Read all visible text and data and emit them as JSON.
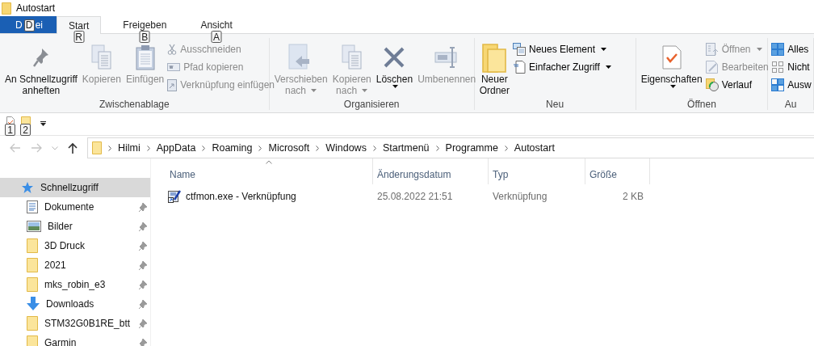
{
  "window": {
    "title": "Autostart"
  },
  "tabs": [
    {
      "label": "D",
      "label_after": "ei",
      "keytip": "D",
      "kind": "file",
      "selected": false
    },
    {
      "label": "Start",
      "keytip": "R",
      "kind": "tab",
      "selected": true
    },
    {
      "label": "Freigeben",
      "keytip": "B",
      "kind": "tab",
      "selected": false
    },
    {
      "label": "Ansicht",
      "keytip": "A",
      "kind": "tab",
      "selected": false
    }
  ],
  "ribbon": [
    {
      "label": "Zwischenablage",
      "items": [
        {
          "kind": "large",
          "lines": [
            "An Schnellzugriff",
            "anheften"
          ],
          "dropdown": false,
          "disabled": false
        },
        {
          "kind": "large",
          "lines": [
            "Kopieren"
          ],
          "dropdown": false,
          "disabled": true
        },
        {
          "kind": "large",
          "lines": [
            "Einfügen"
          ],
          "dropdown": false,
          "disabled": true
        },
        {
          "kind": "small",
          "lines": [
            "Ausschneiden"
          ],
          "dropdown": false,
          "disabled": true
        },
        {
          "kind": "small",
          "lines": [
            "Pfad kopieren"
          ],
          "dropdown": false,
          "disabled": true
        },
        {
          "kind": "small",
          "lines": [
            "Verknüpfung einfügen"
          ],
          "dropdown": false,
          "disabled": true
        }
      ]
    },
    {
      "label": "Organisieren",
      "items": [
        {
          "kind": "large",
          "lines": [
            "Verschieben",
            "nach"
          ],
          "dropdown": true,
          "disabled": true
        },
        {
          "kind": "large",
          "lines": [
            "Kopieren",
            "nach"
          ],
          "dropdown": true,
          "disabled": true
        },
        {
          "kind": "large",
          "lines": [
            "Löschen"
          ],
          "dropdown": true,
          "disabled": false
        },
        {
          "kind": "large",
          "lines": [
            "Umbenennen"
          ],
          "dropdown": false,
          "disabled": true
        }
      ]
    },
    {
      "label": "Neu",
      "items": [
        {
          "kind": "large",
          "lines": [
            "Neuer",
            "Ordner"
          ],
          "dropdown": false,
          "disabled": false
        },
        {
          "kind": "small",
          "lines": [
            "Neues Element"
          ],
          "dropdown": true,
          "disabled": false
        },
        {
          "kind": "small",
          "lines": [
            "Einfacher Zugriff"
          ],
          "dropdown": true,
          "disabled": false
        }
      ]
    },
    {
      "label": "Öffnen",
      "items": [
        {
          "kind": "large",
          "lines": [
            "Eigenschaften"
          ],
          "dropdown": true,
          "disabled": false
        },
        {
          "kind": "small",
          "lines": [
            "Öffnen"
          ],
          "dropdown": true,
          "disabled": true
        },
        {
          "kind": "small",
          "lines": [
            "Bearbeiten"
          ],
          "dropdown": false,
          "disabled": true
        },
        {
          "kind": "small",
          "lines": [
            "Verlauf"
          ],
          "dropdown": false,
          "disabled": false
        }
      ]
    },
    {
      "label": "Au",
      "items": [
        {
          "kind": "small",
          "lines": [
            "Alles"
          ],
          "dropdown": false,
          "disabled": false
        },
        {
          "kind": "small",
          "lines": [
            "Nicht"
          ],
          "dropdown": false,
          "disabled": false
        },
        {
          "kind": "small",
          "lines": [
            "Ausw"
          ],
          "dropdown": false,
          "disabled": false
        }
      ]
    }
  ],
  "quick_access": {
    "keytips": [
      "1",
      "2"
    ]
  },
  "address": {
    "crumbs": [
      "Hilmi",
      "AppData",
      "Roaming",
      "Microsoft",
      "Windows",
      "Startmenü",
      "Programme",
      "Autostart"
    ]
  },
  "sidebar": {
    "items": [
      {
        "label": "Schnellzugriff",
        "kind": "quick",
        "pinned": false,
        "selected": true,
        "children": [
          {
            "label": "Dokumente",
            "kind": "documents",
            "pinned": true,
            "selected": false
          },
          {
            "label": "Bilder",
            "kind": "pictures",
            "pinned": true,
            "selected": false
          },
          {
            "label": "3D Druck",
            "kind": "folder",
            "pinned": true,
            "selected": false
          },
          {
            "label": "2021",
            "kind": "folder",
            "pinned": true,
            "selected": false
          },
          {
            "label": "mks_robin_e3",
            "kind": "folder",
            "pinned": true,
            "selected": false
          },
          {
            "label": "Downloads",
            "kind": "downloads",
            "pinned": true,
            "selected": false
          },
          {
            "label": "STM32G0B1RE_btt",
            "kind": "folder",
            "pinned": true,
            "selected": false
          },
          {
            "label": "Garmin",
            "kind": "folder",
            "pinned": true,
            "selected": false
          }
        ]
      }
    ]
  },
  "table": {
    "columns": [
      {
        "label": "Name",
        "sorted": true
      },
      {
        "label": "Änderungsdatum",
        "sorted": false
      },
      {
        "label": "Typ",
        "sorted": false
      },
      {
        "label": "Größe",
        "sorted": false
      }
    ],
    "rows": [
      {
        "cells": [
          "ctfmon.exe - Verknüpfung",
          "25.08.2022 21:51",
          "Verknüpfung",
          "2 KB"
        ],
        "selected": false
      }
    ]
  }
}
